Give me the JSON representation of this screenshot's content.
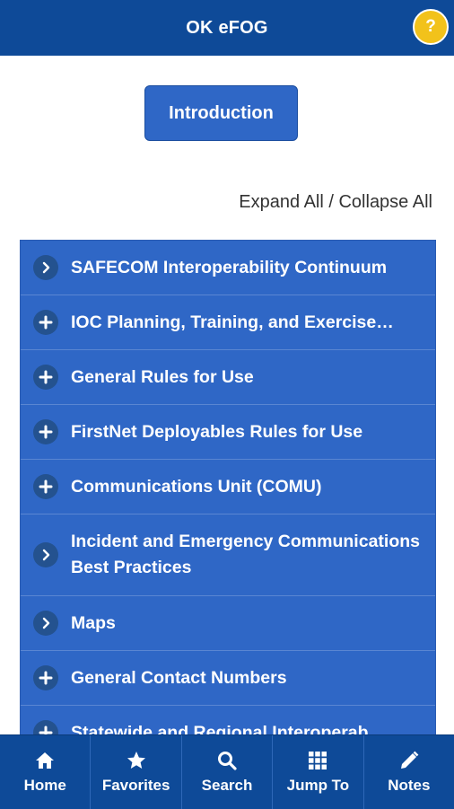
{
  "header": {
    "title": "OK eFOG",
    "help_label": "?"
  },
  "intro_button": {
    "label": "Introduction"
  },
  "toggles": {
    "expand_all": "Expand All",
    "separator": " / ",
    "collapse_all": "Collapse All"
  },
  "accordion": {
    "items": [
      {
        "label": "SAFECOM Interoperability Continuum",
        "icon": "chevron-right-icon"
      },
      {
        "label": "IOC Planning, Training, and Exercise…",
        "icon": "plus-icon"
      },
      {
        "label": "General Rules for Use",
        "icon": "plus-icon"
      },
      {
        "label": "FirstNet Deployables Rules for Use",
        "icon": "plus-icon"
      },
      {
        "label": "Communications Unit (COMU)",
        "icon": "plus-icon"
      },
      {
        "label": "Incident and Emergency Communications Best Practices",
        "icon": "chevron-right-icon"
      },
      {
        "label": "Maps",
        "icon": "chevron-right-icon"
      },
      {
        "label": "General Contact Numbers",
        "icon": "plus-icon"
      },
      {
        "label": "Statewide and Regional Interoperab...",
        "icon": "plus-icon"
      }
    ]
  },
  "bottom_nav": {
    "items": [
      {
        "label": "Home",
        "icon": "home-icon"
      },
      {
        "label": "Favorites",
        "icon": "star-icon"
      },
      {
        "label": "Search",
        "icon": "search-icon"
      },
      {
        "label": "Jump To",
        "icon": "grid-icon"
      },
      {
        "label": "Notes",
        "icon": "pencil-icon"
      }
    ]
  },
  "colors": {
    "header_bg": "#0e4a98",
    "accordion_bg": "#2f67c6",
    "help_badge": "#f2c21b",
    "text_on_dark": "#ffffff"
  }
}
